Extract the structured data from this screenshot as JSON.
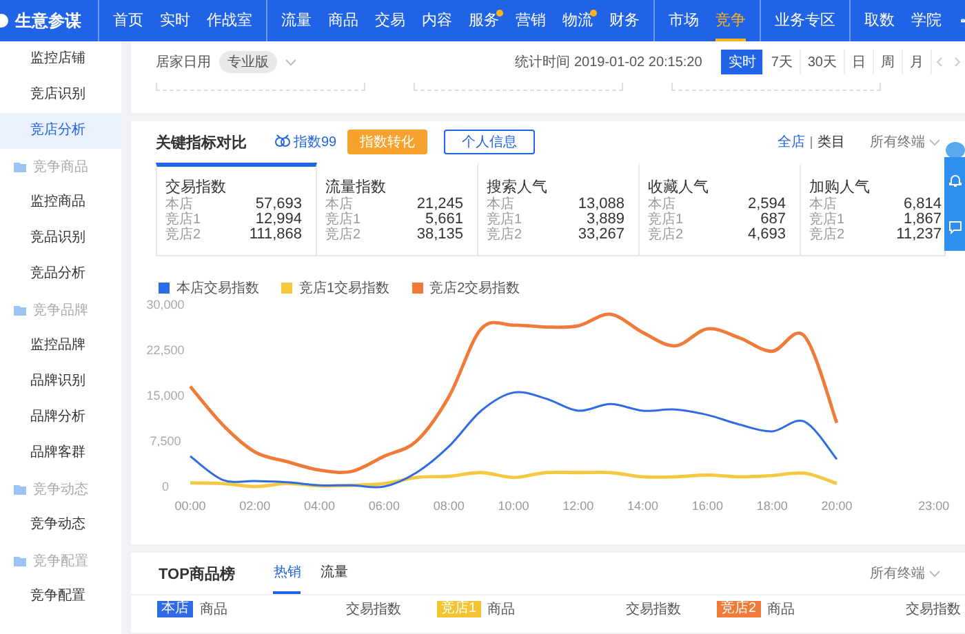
{
  "nav": {
    "brand": "生意参谋",
    "groups": [
      [
        {
          "label": "首页",
          "selected": false,
          "dot": false
        },
        {
          "label": "实时",
          "selected": false,
          "dot": false
        },
        {
          "label": "作战室",
          "selected": false,
          "dot": false
        }
      ],
      [
        {
          "label": "流量",
          "selected": false,
          "dot": false
        },
        {
          "label": "商品",
          "selected": false,
          "dot": false
        },
        {
          "label": "交易",
          "selected": false,
          "dot": false
        },
        {
          "label": "内容",
          "selected": false,
          "dot": false
        },
        {
          "label": "服务",
          "selected": false,
          "dot": true
        },
        {
          "label": "营销",
          "selected": false,
          "dot": false
        },
        {
          "label": "物流",
          "selected": false,
          "dot": true
        },
        {
          "label": "财务",
          "selected": false,
          "dot": false
        }
      ],
      [
        {
          "label": "市场",
          "selected": false,
          "dot": false
        },
        {
          "label": "竞争",
          "selected": true,
          "dot": false
        }
      ],
      [
        {
          "label": "业务专区",
          "selected": false,
          "dot": false
        }
      ],
      [
        {
          "label": "取数",
          "selected": false,
          "dot": false
        },
        {
          "label": "学院",
          "selected": false,
          "dot": false
        }
      ]
    ]
  },
  "sidebar": {
    "sections": [
      {
        "items": [
          {
            "label": "监控店铺",
            "selected": false
          },
          {
            "label": "竞店识别",
            "selected": false
          },
          {
            "label": "竞店分析",
            "selected": true
          }
        ]
      },
      {
        "title": "竞争商品",
        "items": [
          {
            "label": "监控商品",
            "selected": false
          },
          {
            "label": "竞品识别",
            "selected": false
          },
          {
            "label": "竞品分析",
            "selected": false
          }
        ]
      },
      {
        "title": "竞争品牌",
        "items": [
          {
            "label": "监控品牌",
            "selected": false
          },
          {
            "label": "品牌识别",
            "selected": false
          },
          {
            "label": "品牌分析",
            "selected": false
          },
          {
            "label": "品牌客群",
            "selected": false
          }
        ]
      },
      {
        "title": "竞争动态",
        "items": [
          {
            "label": "竞争动态",
            "selected": false
          }
        ]
      },
      {
        "title": "竞争配置",
        "items": [
          {
            "label": "竞争配置",
            "selected": false
          }
        ]
      }
    ]
  },
  "filter_bar": {
    "category": "居家日用",
    "edition": "专业版",
    "stat_time": "统计时间 2019-01-02 20:15:20",
    "ranges": [
      {
        "label": "实时",
        "selected": true
      },
      {
        "label": "7天",
        "selected": false
      },
      {
        "label": "30天",
        "selected": false
      },
      {
        "label": "日",
        "selected": false
      },
      {
        "label": "周",
        "selected": false
      },
      {
        "label": "月",
        "selected": false
      }
    ]
  },
  "key_metrics": {
    "title": "关键指标对比",
    "index_badge": "指数99",
    "buttons": [
      {
        "label": "指数转化",
        "kind": "primary"
      },
      {
        "label": "个人信息",
        "kind": "outline"
      }
    ],
    "scope": [
      {
        "label": "全店",
        "selected": true
      },
      {
        "label": "类目",
        "selected": false
      }
    ],
    "terminal": "所有终端",
    "cards": [
      {
        "title": "交易指数",
        "selected": true,
        "rows": [
          {
            "label": "本店",
            "value": "57,693"
          },
          {
            "label": "竞店1",
            "value": "12,994"
          },
          {
            "label": "竞店2",
            "value": "111,868"
          }
        ]
      },
      {
        "title": "流量指数",
        "selected": false,
        "rows": [
          {
            "label": "本店",
            "value": "21,245"
          },
          {
            "label": "竞店1",
            "value": "5,661"
          },
          {
            "label": "竞店2",
            "value": "38,135"
          }
        ]
      },
      {
        "title": "搜索人气",
        "selected": false,
        "rows": [
          {
            "label": "本店",
            "value": "13,088"
          },
          {
            "label": "竞店1",
            "value": "3,889"
          },
          {
            "label": "竞店2",
            "value": "33,267"
          }
        ]
      },
      {
        "title": "收藏人气",
        "selected": false,
        "rows": [
          {
            "label": "本店",
            "value": "2,594"
          },
          {
            "label": "竞店1",
            "value": "687"
          },
          {
            "label": "竞店2",
            "value": "4,693"
          }
        ]
      },
      {
        "title": "加购人气",
        "selected": false,
        "rows": [
          {
            "label": "本店",
            "value": "6,814"
          },
          {
            "label": "竞店1",
            "value": "1,867"
          },
          {
            "label": "竞店2",
            "value": "11,237"
          }
        ]
      }
    ],
    "chart_data": {
      "type": "line",
      "x": [
        0,
        1,
        2,
        3,
        4,
        5,
        6,
        7,
        8,
        9,
        10,
        11,
        12,
        13,
        14,
        15,
        16,
        17,
        18,
        19,
        20
      ],
      "xlim": [
        0,
        23
      ],
      "xticks": [
        {
          "value": 0,
          "label": "00:00"
        },
        {
          "value": 2,
          "label": "02:00"
        },
        {
          "value": 4,
          "label": "04:00"
        },
        {
          "value": 6,
          "label": "06:00"
        },
        {
          "value": 8,
          "label": "08:00"
        },
        {
          "value": 10,
          "label": "10:00"
        },
        {
          "value": 12,
          "label": "12:00"
        },
        {
          "value": 14,
          "label": "14:00"
        },
        {
          "value": 16,
          "label": "16:00"
        },
        {
          "value": 18,
          "label": "18:00"
        },
        {
          "value": 20,
          "label": "20:00"
        },
        {
          "value": 23,
          "label": "23:00"
        }
      ],
      "ylim": [
        0,
        30000
      ],
      "yticks": [
        {
          "value": 0,
          "label": "0"
        },
        {
          "value": 7500,
          "label": "7,500"
        },
        {
          "value": 15000,
          "label": "15,000"
        },
        {
          "value": 22500,
          "label": "22,500"
        },
        {
          "value": 30000,
          "label": "30,000"
        }
      ],
      "series": [
        {
          "name": "本店交易指数",
          "color": "#2f6be6",
          "values": [
            5000,
            1100,
            900,
            700,
            200,
            200,
            0,
            2300,
            6600,
            12500,
            15500,
            14500,
            12500,
            13600,
            12500,
            12700,
            11800,
            10200,
            9100,
            10700,
            4500
          ]
        },
        {
          "name": "竞店1交易指数",
          "color": "#f5c842",
          "values": [
            600,
            500,
            0,
            500,
            100,
            200,
            500,
            1500,
            1700,
            2300,
            1500,
            2300,
            2300,
            2300,
            1600,
            1600,
            1900,
            1600,
            1800,
            2200,
            500
          ]
        },
        {
          "name": "竞店2交易指数",
          "color": "#ef7a3a",
          "values": [
            16500,
            10200,
            5700,
            4100,
            2700,
            2500,
            5000,
            7500,
            14800,
            26000,
            26600,
            26300,
            26500,
            28400,
            25400,
            23200,
            26000,
            24500,
            22300,
            24800,
            10500
          ]
        }
      ]
    }
  },
  "top_products": {
    "title": "TOP商品榜",
    "tabs": [
      {
        "label": "热销",
        "selected": true
      },
      {
        "label": "流量",
        "selected": false
      }
    ],
    "terminal": "所有终端",
    "columns": [
      {
        "badge": "本店",
        "color": "#2f6be6",
        "product": "商品",
        "index": "交易指数"
      },
      {
        "badge": "竞店1",
        "color": "#f2c230",
        "product": "商品",
        "index": "交易指数"
      },
      {
        "badge": "竞店2",
        "color": "#ef7a3a",
        "product": "商品",
        "index": "交易指数"
      }
    ]
  }
}
